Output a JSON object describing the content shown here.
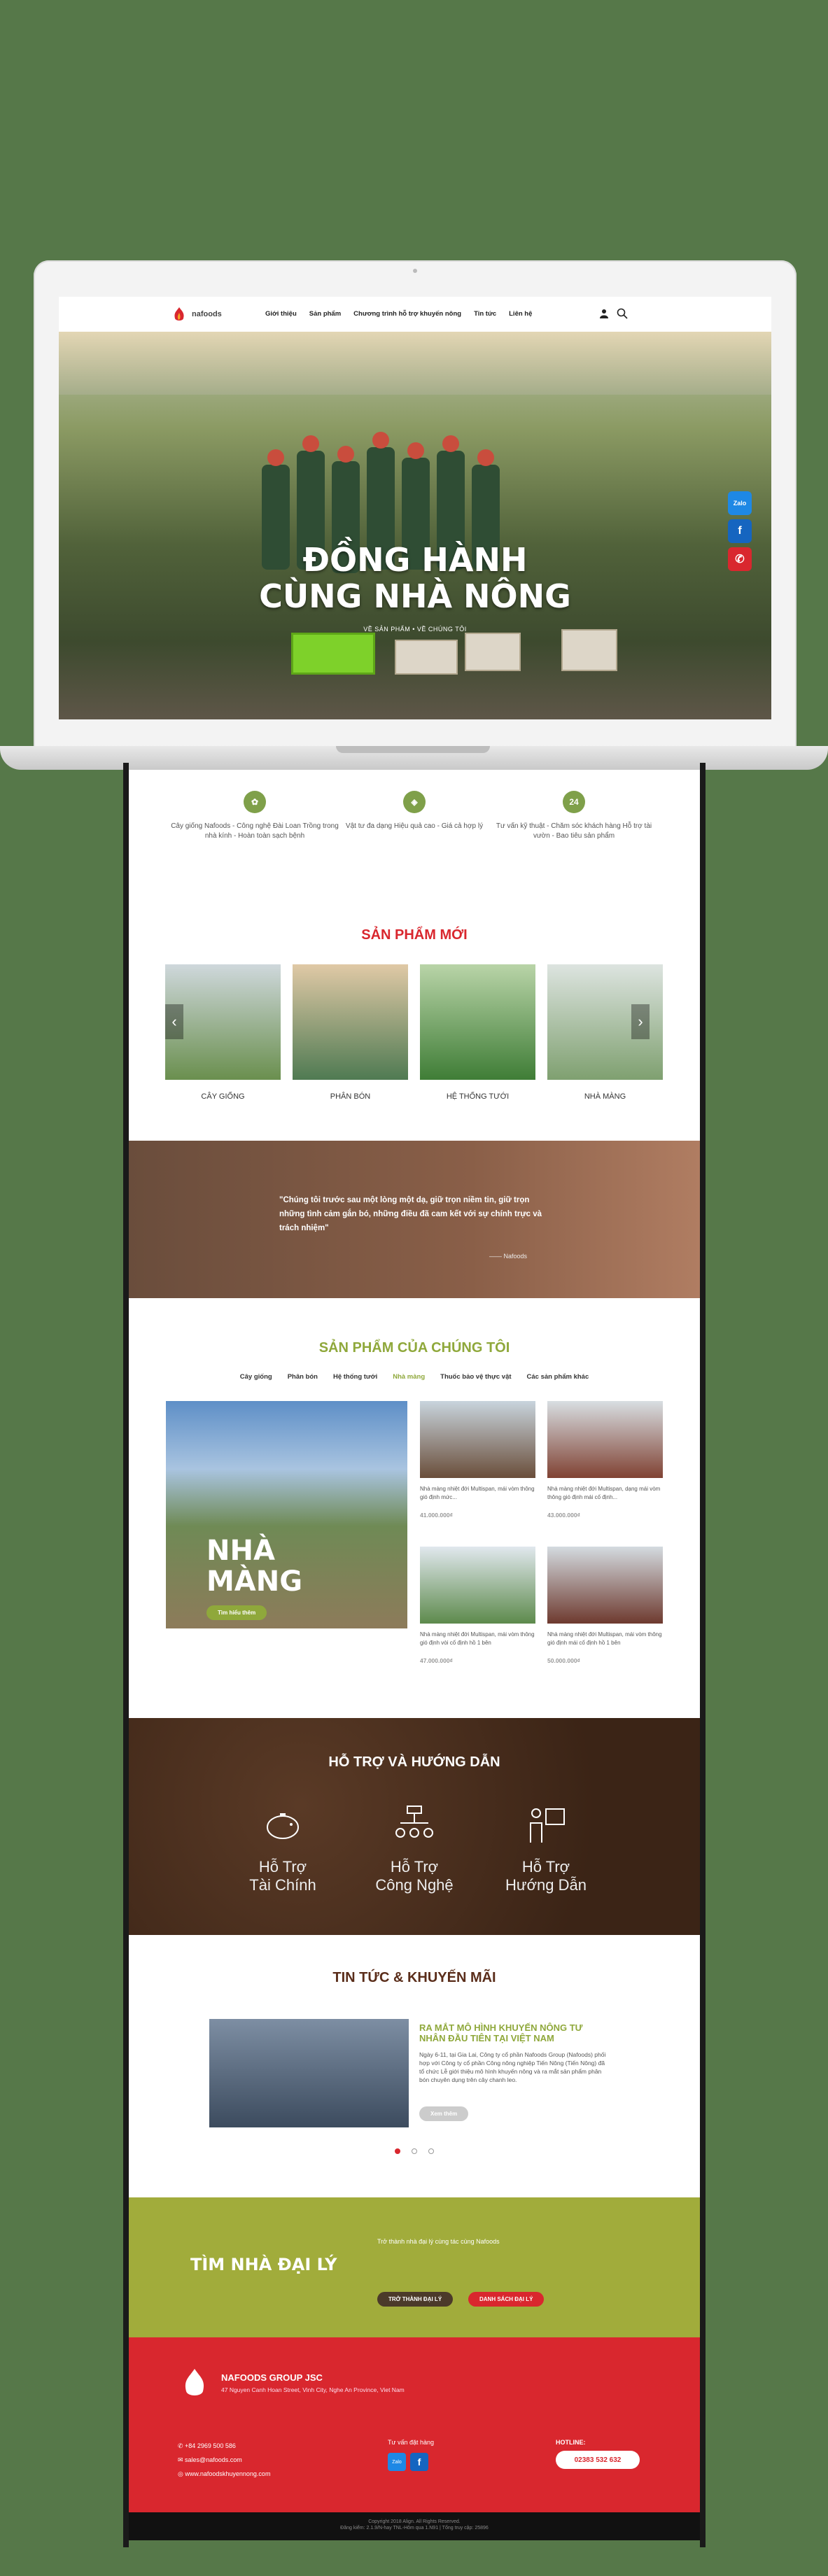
{
  "nav": {
    "brand": "nafoods",
    "items": [
      "Giới thiệu",
      "Sản phẩm",
      "Chương trình hỗ trợ khuyến nông",
      "Tin tức",
      "Liên hệ"
    ]
  },
  "hero": {
    "title_line1": "ĐỒNG HÀNH",
    "title_line2": "CÙNG NHÀ NÔNG",
    "links": "VỀ SẢN PHẨM  •  VỀ CHÚNG TÔI",
    "social": [
      "Zalo",
      "f",
      "✆"
    ]
  },
  "features": [
    {
      "icon": "seedling-icon",
      "text": "Cây giống Nafoods - Công nghệ Đài Loan Trồng trong nhà kính - Hoàn toàn sạch bệnh"
    },
    {
      "icon": "sack-icon",
      "text": "Vật tư đa dạng Hiệu quả cao - Giá cả hợp lý"
    },
    {
      "icon": "support-24-icon",
      "text": "Tư vấn kỹ thuật - Chăm sóc khách hàng Hỗ trợ tài vườn - Bao tiêu sản phẩm"
    }
  ],
  "new_products": {
    "title": "SẢN PHẨM MỚI",
    "items": [
      "CÂY GIỐNG",
      "PHÂN BÓN",
      "HỆ THỐNG TƯỚI",
      "NHÀ MÀNG"
    ]
  },
  "quote": {
    "text": "\"Chúng tôi trước sau một lòng một dạ, giữ trọn niềm tin, giữ trọn những tình cảm gắn bó, những điều đã cam kết với sự chính trực và trách nhiệm\"",
    "author": "—— Nafoods"
  },
  "our_products": {
    "title": "SẢN PHẨM CỦA CHÚNG TÔI",
    "tabs": [
      "Cây giống",
      "Phân bón",
      "Hệ thống tưới",
      "Nhà màng",
      "Thuốc bảo vệ thực vật",
      "Các sản phẩm khác"
    ],
    "active_tab": "Nhà màng",
    "feature_title_1": "NHÀ",
    "feature_title_2": "MÀNG",
    "feature_button": "Tìm hiểu thêm",
    "cards": [
      {
        "desc": "Nhà màng nhiệt đới Multispan, mái vòm thông gió định mức...",
        "price": "41.000.000₫"
      },
      {
        "desc": "Nhà màng nhiệt đới Multispan, dạng mái vòm thông gió định mái cố định...",
        "price": "43.000.000₫"
      },
      {
        "desc": "Nhà màng nhiệt đới Multispan, mái vòm thông gió định vòi cố định hồ 1 bên",
        "price": "47.000.000₫"
      },
      {
        "desc": "Nhà màng nhiệt đới Multispan, mái vòm thông gió định mái cố định hồ 1 bên",
        "price": "50.000.000₫"
      }
    ]
  },
  "support": {
    "title": "HỖ TRỢ VÀ HƯỚNG DẪN",
    "items": [
      {
        "line1": "Hỗ Trợ",
        "line2": "Tài Chính"
      },
      {
        "line1": "Hỗ Trợ",
        "line2": "Công Nghệ"
      },
      {
        "line1": "Hỗ Trợ",
        "line2": "Hướng Dẫn"
      }
    ]
  },
  "news": {
    "title": "TIN TỨC & KHUYẾN MÃI",
    "headline": "RA MẮT MÔ HÌNH KHUYẾN NÔNG TƯ NHÂN ĐẦU TIÊN TẠI VIỆT NAM",
    "body": "Ngày 6-11, tại Gia Lai, Công ty cổ phần Nafoods Group (Nafoods) phối hợp với Công ty cổ phần Công nông nghiệp Tiến Nông (Tiến Nông) đã tổ chức Lễ giới thiệu mô hình khuyến nông và ra mắt sản phẩm phân bón chuyên dụng trên cây chanh leo.",
    "button": "Xem thêm"
  },
  "dealer": {
    "subtitle": "Trở thành nhà đại lý cùng tác cùng Nafoods",
    "title": "TÌM NHÀ ĐẠI LÝ",
    "btn_become": "TRỞ THÀNH ĐẠI LÝ",
    "btn_list": "DANH SÁCH ĐẠI LÝ"
  },
  "footer": {
    "company": "NAFOODS GROUP JSC",
    "address": "47 Nguyen Canh Hoan Street, Vinh City, Nghe An Province, Viet Nam",
    "phone": "+84 2969 500 586",
    "email": "sales@nafoods.com",
    "web": "www.nafoodskhuyennong.com",
    "consult": "Tư vấn đặt hàng",
    "hotline_label": "HOTLINE:",
    "hotline": "02383 532 632",
    "copyright": "Copyright 2018 Align. All Rights Reserved.",
    "legal": "Đăng kiểm: 2.1.9/N-hay TNL-Hôm qua 1.N91 | Tổng truy cập: 25896"
  },
  "colors": {
    "brand_red": "#d9272e",
    "brand_green": "#7fa04a",
    "cta_olive": "#a1ac3b",
    "bg": "#567849"
  }
}
